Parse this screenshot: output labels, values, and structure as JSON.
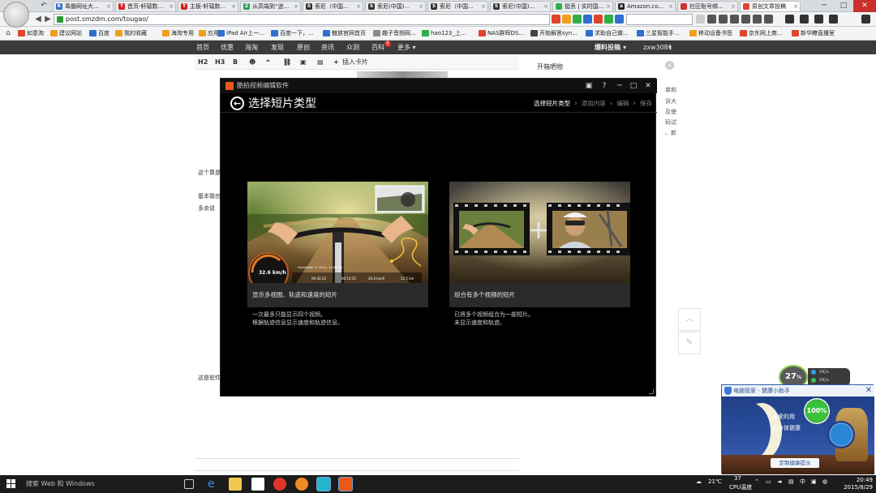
{
  "browser": {
    "tabs": [
      {
        "label": "毒霸网址大...",
        "fav": "K",
        "color": "#2e6fd1"
      },
      {
        "label": "首页-轩辕数...",
        "fav": "T",
        "color": "#d32222"
      },
      {
        "label": "主板-轩辕数...",
        "fav": "T",
        "color": "#d32222"
      },
      {
        "label": "从高端到“迷...",
        "fav": "Z",
        "color": "#2a9d5a"
      },
      {
        "label": "索尼（中国...",
        "fav": "S",
        "color": "#333333"
      },
      {
        "label": "索尼(中国)...",
        "fav": "S",
        "color": "#333333"
      },
      {
        "label": "索尼（中国...",
        "fav": "S",
        "color": "#333333"
      },
      {
        "label": "索尼(中国)...",
        "fav": "S",
        "color": "#333333"
      },
      {
        "label": "挺丢 | 实时国...",
        "fav": "",
        "color": "#2fae4a"
      },
      {
        "label": "Amazon.co...",
        "fav": "a",
        "color": "#222222"
      },
      {
        "label": "社区账号绑...",
        "fav": "",
        "color": "#cc3333"
      },
      {
        "label": "原创文章投稿",
        "fav": "",
        "color": "#e0452b",
        "active": true
      }
    ],
    "url": "post.smzdm.com/tougao/",
    "bookmarks": [
      {
        "label": "如意淘",
        "color": "#e0452b"
      },
      {
        "label": "建议网站",
        "color": "#f0a020"
      },
      {
        "label": "百度",
        "color": "#2e6fd1"
      },
      {
        "label": "我的收藏",
        "color": "#f0a020"
      },
      {
        "label": "海淘专用",
        "color": "#f0a020"
      },
      {
        "label": "应用",
        "color": "#f0a020"
      },
      {
        "label": "iPad Air上一...",
        "color": "#2e6fd1"
      },
      {
        "label": "百度一下，...",
        "color": "#2e6fd1"
      },
      {
        "label": "魅族官网首页",
        "color": "#2e6fd1"
      },
      {
        "label": "趣子音频网...",
        "color": "#8a8a8a"
      },
      {
        "label": "hao123_上...",
        "color": "#2fae4a"
      },
      {
        "label": "NAS群晖DS...",
        "color": "#e0452b"
      },
      {
        "label": "开始解答syn...",
        "color": "#444444"
      },
      {
        "label": "求助自己做...",
        "color": "#2e6fd1"
      },
      {
        "label": "三星智能手...",
        "color": "#2e6fd1"
      },
      {
        "label": "移动设备书签",
        "color": "#f0a020"
      },
      {
        "label": "京东网上商...",
        "color": "#e0452b"
      },
      {
        "label": "新华瞭直播室",
        "color": "#e0452b"
      }
    ]
  },
  "site_nav": {
    "items": [
      "首页",
      "优惠",
      "海淘",
      "发现",
      "原创",
      "资讯",
      "众测",
      "百科",
      "更多"
    ],
    "baike_badge": "8",
    "right_items": [
      "爆料投稿",
      "zxw3081"
    ]
  },
  "editor": {
    "toolbar": [
      "H2",
      "H3",
      "B",
      "☻",
      "❝",
      "⛓",
      "▣",
      "▤"
    ],
    "insert_card": "插入卡片",
    "text_fragments": [
      "这个算是",
      "基本我也",
      "多余说",
      "这是软件"
    ]
  },
  "right_panel": {
    "title": "开箱晒物",
    "close": "×",
    "fragments": [
      "单和",
      "诉大",
      "及使",
      "码试",
      "、新"
    ]
  },
  "modal": {
    "app_title": "酷拍视频编辑软件",
    "page_title": "选择短片类型",
    "steps": [
      "选择短片类型",
      "添加内容",
      "编辑",
      "保存"
    ],
    "cards": [
      {
        "caption": "显示多视图、轨迹和速度的短片",
        "desc1": "一次最多只能显示四个视频。",
        "desc2": "根据轨迹信息显示速度和轨迹信息。",
        "speed": "32.6 km/h",
        "hud_date": "September 21 2014 - 12:00 PM",
        "hud_t1": "00:42:23",
        "hud_t2": "00:12:35",
        "hud_t3": "26.4 km/h",
        "hud_t4": "22.5 km"
      },
      {
        "caption": "组合有多个视频的短片",
        "desc1": "已将多个视频组合为一部短片。",
        "desc2": "未显示速度和轨迹。"
      }
    ]
  },
  "popup": {
    "title": "电脑管家 - 健康小助手",
    "line1": "亲爱的用",
    "line2": "的身体健康",
    "gauge": "100%",
    "button": "定制健康提示"
  },
  "cpu_widget": {
    "percent": "27",
    "unit": "%",
    "up": "0K/s",
    "down": "0K/s"
  },
  "taskbar": {
    "search": "搜索 Web 和 Windows",
    "temp": "21℃",
    "cpu_label": "CPU温度",
    "cpu_temp": "37",
    "ime": "中",
    "time": "20:49",
    "date": "2015/8/29"
  }
}
